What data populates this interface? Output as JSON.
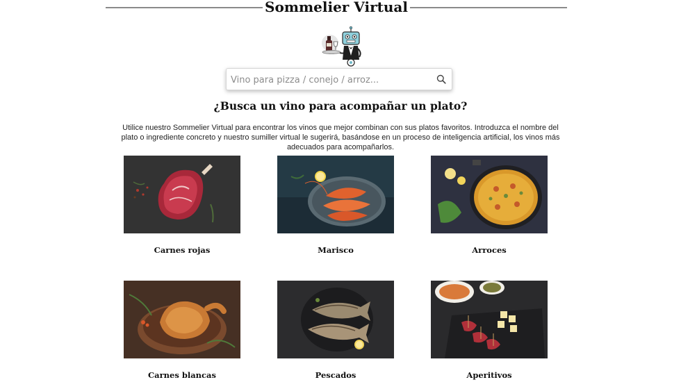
{
  "header": {
    "title": "Sommelier Virtual",
    "mascot_icon": "robot-waiter-icon"
  },
  "search": {
    "placeholder": "Vino para pizza / conejo / arroz...",
    "value": "",
    "icon": "search-icon"
  },
  "intro": {
    "heading": "¿Busca un vino para acompañar un plato?",
    "text": "Utilice nuestro Sommelier Virtual para encontrar los vinos que mejor combinan con sus platos favoritos. Introduzca el nombre del plato o ingrediente concreto y nuestro sumiller virtual le sugerirá, basándose en un proceso de inteligencia artificial, los vinos más adecuados para acompañarlos."
  },
  "categories": [
    {
      "label": "Carnes rojas",
      "image": "raw-steak-photo"
    },
    {
      "label": "Marisco",
      "image": "prawns-platter-photo"
    },
    {
      "label": "Arroces",
      "image": "paella-pan-photo"
    },
    {
      "label": "Carnes blancas",
      "image": "roast-chicken-photo"
    },
    {
      "label": "Pescados",
      "image": "grilled-fish-photo"
    },
    {
      "label": "Aperitivos",
      "image": "tapas-board-photo"
    }
  ]
}
